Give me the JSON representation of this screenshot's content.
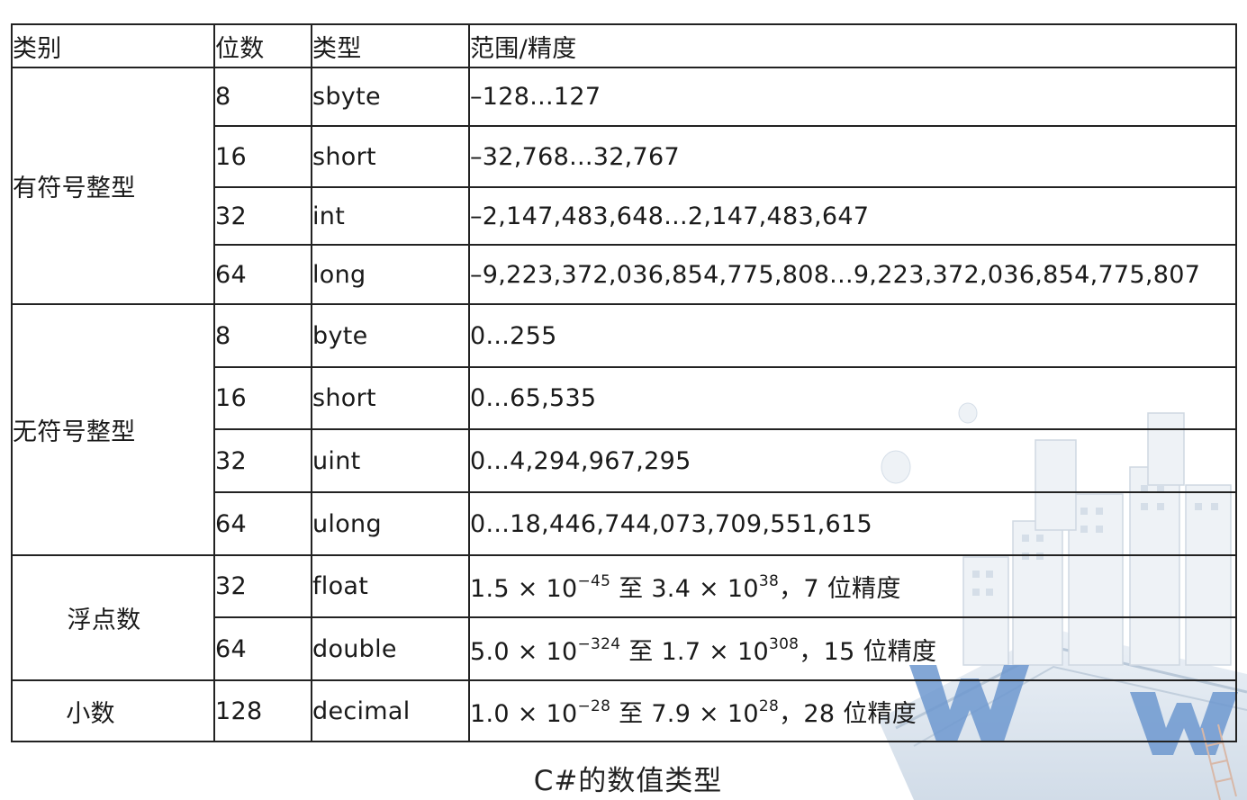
{
  "header": {
    "category": "类别",
    "bits": "位数",
    "type": "类型",
    "range": "范围/精度"
  },
  "groups": {
    "signed": "有符号整型",
    "unsigned": "无符号整型",
    "float": "浮点数",
    "decimal": "小数"
  },
  "rows": [
    {
      "bits": "8",
      "type": "sbyte",
      "range": "–128...127"
    },
    {
      "bits": "16",
      "type": "short",
      "range": "–32,768...32,767"
    },
    {
      "bits": "32",
      "type": "int",
      "range": "–2,147,483,648...2,147,483,647"
    },
    {
      "bits": "64",
      "type": "long",
      "range": "–9,223,372,036,854,775,808...9,223,372,036,854,775,807"
    },
    {
      "bits": "8",
      "type": "byte",
      "range": "0...255"
    },
    {
      "bits": "16",
      "type": "short",
      "range": "0...65,535"
    },
    {
      "bits": "32",
      "type": "uint",
      "range": "0...4,294,967,295"
    },
    {
      "bits": "64",
      "type": "ulong",
      "range": "0...18,446,744,073,709,551,615"
    },
    {
      "bits": "32",
      "type": "float",
      "range": {
        "pre": "1.5 × 10",
        "exp1": "−45",
        "mid": " 至 3.4 × 10",
        "exp2": "38",
        "post": "，7  位精度"
      }
    },
    {
      "bits": "64",
      "type": "double",
      "range": {
        "pre": "5.0 × 10",
        "exp1": "−324",
        "mid": " 至 1.7 × 10",
        "exp2": "308",
        "post": "，15  位精度"
      }
    },
    {
      "bits": "128",
      "type": "decimal",
      "range": {
        "pre": "1.0 × 10",
        "exp1": "−28",
        "mid": " 至 7.9 × 10",
        "exp2": "28",
        "post": "，28  位精度"
      }
    }
  ],
  "caption": "C#的数值类型"
}
